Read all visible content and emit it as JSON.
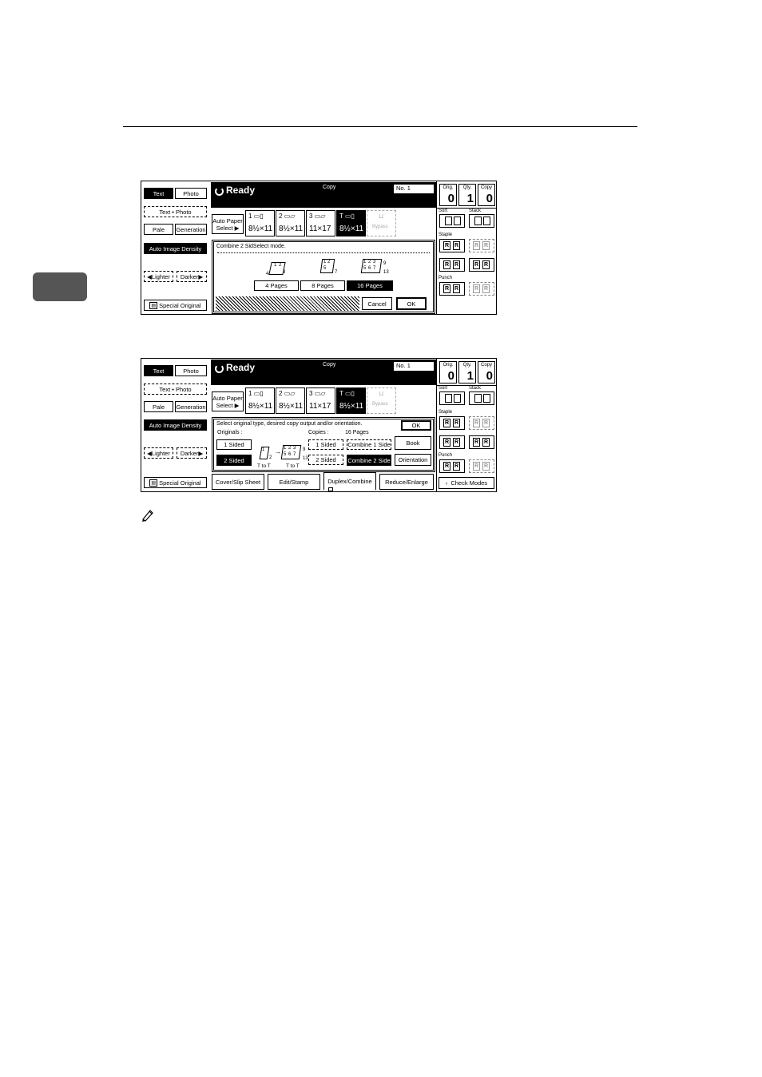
{
  "panel1": {
    "left": {
      "text": "Text",
      "photo": "Photo",
      "text_photo": "Text • Photo",
      "pale": "Pale",
      "generation": "Generation",
      "auto_density": "Auto Image Density",
      "lighter": "Lighter",
      "darker": "Darker",
      "special_original": "Special Original"
    },
    "status": {
      "ready": "Ready",
      "copy": "Copy",
      "no_label": "No. 1"
    },
    "counters": [
      {
        "label": "Orig.",
        "value": "0"
      },
      {
        "label": "Qty.",
        "value": "1"
      },
      {
        "label": "Copy",
        "value": "0"
      }
    ],
    "trays": {
      "auto_paper_line1": "Auto Paper",
      "auto_paper_line2": "Select ▶",
      "items": [
        {
          "num": "1",
          "size": "8½×11"
        },
        {
          "num": "2",
          "size": "8½×11"
        },
        {
          "num": "3",
          "size": "11×17"
        },
        {
          "num": "T",
          "size": "8½×11"
        },
        {
          "num": "",
          "size": "Bypass"
        }
      ]
    },
    "finish": {
      "sort": "Sort",
      "stack": "Stack",
      "staple": "Staple",
      "punch": "Punch"
    },
    "dialog": {
      "message": "Combine 2 SidSelect mode.",
      "thumb_4": {
        "a": "1",
        "b": "2",
        "c": "3",
        "d": "4"
      },
      "thumb_8": {
        "a": "1",
        "b": "2",
        "c": "5",
        "d": "7"
      },
      "thumb_16": {
        "a": "1",
        "b": "2",
        "c": "3",
        "d": "9",
        "e": "5",
        "f": "6",
        "g": "7",
        "h": "13"
      },
      "options": [
        "4 Pages",
        "8 Pages",
        "16 Pages"
      ],
      "cancel": "Cancel",
      "ok": "OK"
    }
  },
  "panel2": {
    "left": {
      "text": "Text",
      "photo": "Photo",
      "text_photo": "Text • Photo",
      "pale": "Pale",
      "generation": "Generation",
      "auto_density": "Auto Image Density",
      "lighter": "Lighter",
      "darker": "Darker",
      "special_original": "Special Original"
    },
    "status": {
      "ready": "Ready",
      "copy": "Copy",
      "no_label": "No. 1"
    },
    "counters": [
      {
        "label": "Orig.",
        "value": "0"
      },
      {
        "label": "Qty.",
        "value": "1"
      },
      {
        "label": "Copy",
        "value": "0"
      }
    ],
    "trays": {
      "auto_paper_line1": "Auto Paper",
      "auto_paper_line2": "Select ▶",
      "items": [
        {
          "num": "1",
          "size": "8½×11"
        },
        {
          "num": "2",
          "size": "8½×11"
        },
        {
          "num": "3",
          "size": "11×17"
        },
        {
          "num": "T",
          "size": "8½×11"
        },
        {
          "num": "",
          "size": "Bypass"
        }
      ]
    },
    "finish": {
      "sort": "Sort",
      "stack": "Stack",
      "staple": "Staple",
      "punch": "Punch"
    },
    "duplex": {
      "message": "Select original type, desired copy output and/or orientation.",
      "ok": "OK",
      "originals_label": "Originals :",
      "copies_label": "Copies :",
      "copies_value": "16 Pages",
      "one_sided": "1 Sided",
      "two_sided": "2 Sided",
      "copy_one_sided": "1 Sided",
      "copy_two_sided": "2 Sided",
      "combine_one": "Combine 1 Side",
      "combine_two": "Combine 2 Side",
      "book": "Book",
      "orientation": "Orientation",
      "t_to_t_1": "T to T",
      "t_to_t_2": "T to T",
      "orig_thumb": {
        "a": "1",
        "b": "2"
      },
      "copy_thumb": {
        "a": "1",
        "b": "2",
        "c": "3",
        "d": "9",
        "e": "5",
        "f": "6",
        "g": "7",
        "h": "13"
      }
    },
    "tabs": [
      "Cover/Slip Sheet",
      "Edit/Stamp",
      "Duplex/Combine",
      "Reduce/Enlarge"
    ],
    "check_modes": "Check Modes"
  },
  "colors": {
    "ink": "#000000",
    "tab_marker": "#555555"
  }
}
